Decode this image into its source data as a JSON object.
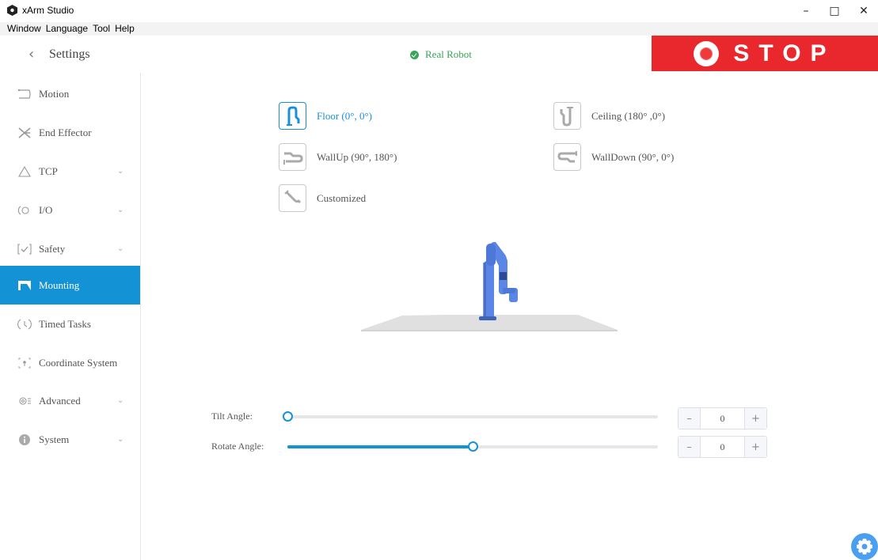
{
  "window": {
    "title": "xArm Studio",
    "minimize_icon": "minimize-icon",
    "maximize_icon": "maximize-icon",
    "close_icon": "close-icon"
  },
  "menu": [
    "Window",
    "Language",
    "Tool",
    "Help"
  ],
  "header": {
    "back_icon": "chevron-left-icon",
    "title": "Settings",
    "status_text": "Real Robot",
    "status_color": "#3aa55a",
    "stop_label": "STOP",
    "stop_color": "#e8282c"
  },
  "sidebar": {
    "accent": "#1492d6",
    "items": [
      {
        "label": "Motion",
        "icon": "motion-icon",
        "expandable": false,
        "active": false
      },
      {
        "label": "End Effector",
        "icon": "end-effector-icon",
        "expandable": false,
        "active": false
      },
      {
        "label": "TCP",
        "icon": "tcp-icon",
        "expandable": true,
        "active": false
      },
      {
        "label": "I/O",
        "icon": "io-icon",
        "expandable": true,
        "active": false
      },
      {
        "label": "Safety",
        "icon": "safety-icon",
        "expandable": true,
        "active": false
      },
      {
        "label": "Mounting",
        "icon": "mounting-icon",
        "expandable": false,
        "active": true
      },
      {
        "label": "Timed Tasks",
        "icon": "timed-tasks-icon",
        "expandable": false,
        "active": false
      },
      {
        "label": "Coordinate System",
        "icon": "coordinate-system-icon",
        "expandable": false,
        "active": false
      },
      {
        "label": "Advanced",
        "icon": "advanced-icon",
        "expandable": true,
        "active": false
      },
      {
        "label": "System",
        "icon": "system-icon",
        "expandable": true,
        "active": false
      }
    ]
  },
  "mounting": {
    "options": [
      {
        "label": "Floor (0°, 0°)",
        "icon": "floor-mount-icon",
        "selected": true
      },
      {
        "label": "Ceiling (180° ,0°)",
        "icon": "ceiling-mount-icon",
        "selected": false
      },
      {
        "label": "WallUp (90°, 180°)",
        "icon": "wallup-mount-icon",
        "selected": false
      },
      {
        "label": "WallDown (90°, 0°)",
        "icon": "walldown-mount-icon",
        "selected": false
      },
      {
        "label": "Customized",
        "icon": "customized-mount-icon",
        "selected": false
      }
    ],
    "robot_color": "#5b86e5"
  },
  "sliders": {
    "tilt": {
      "label": "Tilt Angle:",
      "value": "0",
      "position": 0.0
    },
    "rotate": {
      "label": "Rotate Angle:",
      "value": "0",
      "position": 0.5
    }
  },
  "fab_icon": "gear-icon"
}
